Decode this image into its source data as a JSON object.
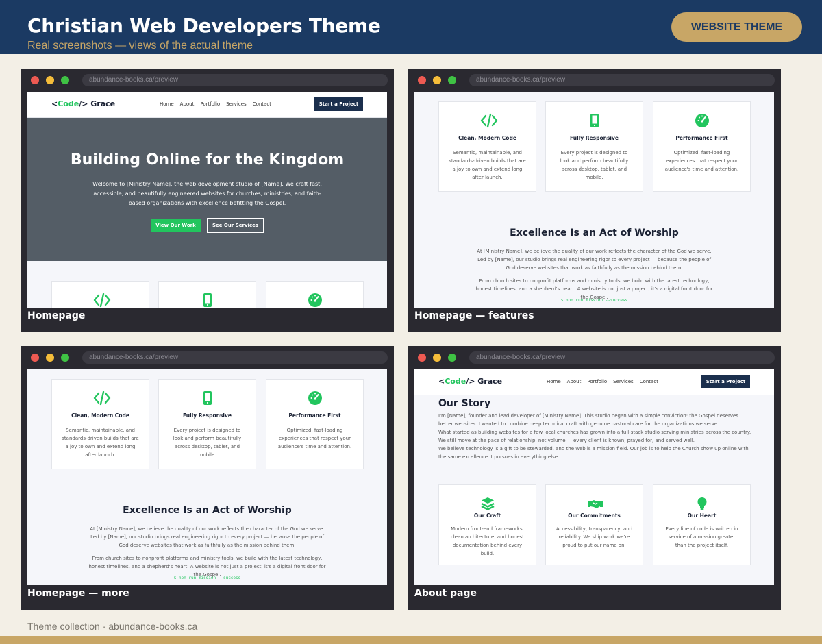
{
  "header": {
    "title": "Christian Web Developers Theme",
    "subtitle": "Real screenshots — views of the actual theme",
    "button_label": "WEBSITE THEME"
  },
  "browser": {
    "url": "abundance-books.ca/preview"
  },
  "captions": [
    "Homepage",
    "Homepage — features",
    "Homepage — more",
    "About page"
  ],
  "site": {
    "logo_prefix": "<",
    "logo_code": "Code",
    "logo_suffix": "/> Grace",
    "nav": [
      "Home",
      "About",
      "Portfolio",
      "Services",
      "Contact"
    ],
    "cta": "Start a Project",
    "hero_title": "Building Online for the Kingdom",
    "hero_text": "Welcome to [Ministry Name], the web development studio of [Name]. We craft fast, accessible, and beautifully engineered websites for churches, ministries, and faith-based organizations with excellence befitting the Gospel.",
    "hero_primary": "View Our Work",
    "hero_secondary": "See Our Services",
    "features": [
      {
        "title": "Clean, Modern Code",
        "text": "Semantic, maintainable, and standards-driven builds that are a joy to own and extend long after launch."
      },
      {
        "title": "Fully Responsive",
        "text": "Every project is designed to look and perform beautifully across desktop, tablet, and mobile."
      },
      {
        "title": "Performance First",
        "text": "Optimized, fast-loading experiences that respect your audience's time and attention."
      }
    ],
    "worship_title": "Excellence Is an Act of Worship",
    "worship_p1": "At [Ministry Name], we believe the quality of our work reflects the character of the God we serve. Led by [Name], our studio brings real engineering rigor to every project — because the people of God deserve websites that work as faithfully as the mission behind them.",
    "worship_p2": "From church sites to nonprofit platforms and ministry tools, we build with the latest technology, honest timelines, and a shepherd's heart. A website is not just a project; it's a digital front door for the Gospel.",
    "code_line": "$ npm run mission --success",
    "story_title": "Our Story",
    "story_p1": "I'm [Name], founder and lead developer of [Ministry Name]. This studio began with a simple conviction: the Gospel deserves better websites. I wanted to combine deep technical craft with genuine pastoral care for the organizations we serve.",
    "story_p2": "What started as building websites for a few local churches has grown into a full-stack studio serving ministries across the country. We still move at the pace of relationship, not volume — every client is known, prayed for, and served well.",
    "story_p3": "We believe technology is a gift to be stewarded, and the web is a mission field. Our job is to help the Church show up online with the same excellence it pursues in everything else.",
    "values": [
      {
        "title": "Our Craft",
        "text": "Modern front-end frameworks, clean architecture, and honest documentation behind every build."
      },
      {
        "title": "Our Commitments",
        "text": "Accessibility, transparency, and reliability. We ship work we're proud to put our name on."
      },
      {
        "title": "Our Heart",
        "text": "Every line of code is written in service of a mission greater than the project itself."
      }
    ]
  },
  "footer": {
    "note": "Theme collection · abundance-books.ca"
  },
  "colors": {
    "navy": "#1b3a63",
    "gold": "#c8a666",
    "green": "#22c55e",
    "frame": "#2a2930",
    "cream": "#f3efe6"
  }
}
